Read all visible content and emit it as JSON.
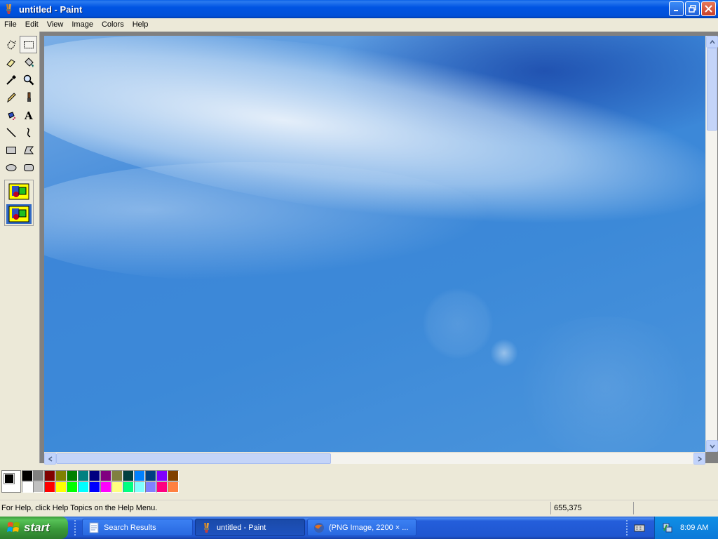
{
  "window": {
    "title": "untitled - Paint"
  },
  "menu": [
    "File",
    "Edit",
    "View",
    "Image",
    "Colors",
    "Help"
  ],
  "tools": [
    {
      "name": "free-form-select-tool",
      "selected": false
    },
    {
      "name": "select-tool",
      "selected": true
    },
    {
      "name": "eraser-tool",
      "selected": false
    },
    {
      "name": "fill-with-color-tool",
      "selected": false
    },
    {
      "name": "pick-color-tool",
      "selected": false
    },
    {
      "name": "magnifier-tool",
      "selected": false
    },
    {
      "name": "pencil-tool",
      "selected": false
    },
    {
      "name": "brush-tool",
      "selected": false
    },
    {
      "name": "airbrush-tool",
      "selected": false
    },
    {
      "name": "text-tool",
      "selected": false
    },
    {
      "name": "line-tool",
      "selected": false
    },
    {
      "name": "curve-tool",
      "selected": false
    },
    {
      "name": "rectangle-tool",
      "selected": false
    },
    {
      "name": "polygon-tool",
      "selected": false
    },
    {
      "name": "ellipse-tool",
      "selected": false
    },
    {
      "name": "rounded-rectangle-tool",
      "selected": false
    }
  ],
  "palette": {
    "foreground": "#000000",
    "background": "#ffffff",
    "colors": [
      "#000000",
      "#808080",
      "#800000",
      "#808000",
      "#008000",
      "#008080",
      "#000080",
      "#800080",
      "#808040",
      "#004040",
      "#0080ff",
      "#004080",
      "#8000ff",
      "#804000",
      "#ffffff",
      "#c0c0c0",
      "#ff0000",
      "#ffff00",
      "#00ff00",
      "#00ffff",
      "#0000ff",
      "#ff00ff",
      "#ffff80",
      "#00ff80",
      "#80ffff",
      "#8080ff",
      "#ff0080",
      "#ff8040"
    ]
  },
  "status": {
    "help_text": "For Help, click Help Topics on the Help Menu.",
    "coordinates": "655,375"
  },
  "taskbar": {
    "start_label": "start",
    "tasks": [
      {
        "label": "Search Results",
        "active": false
      },
      {
        "label": "untitled - Paint",
        "active": true
      },
      {
        "label": "(PNG Image, 2200 × ...",
        "active": false
      }
    ],
    "clock": "8:09 AM"
  }
}
